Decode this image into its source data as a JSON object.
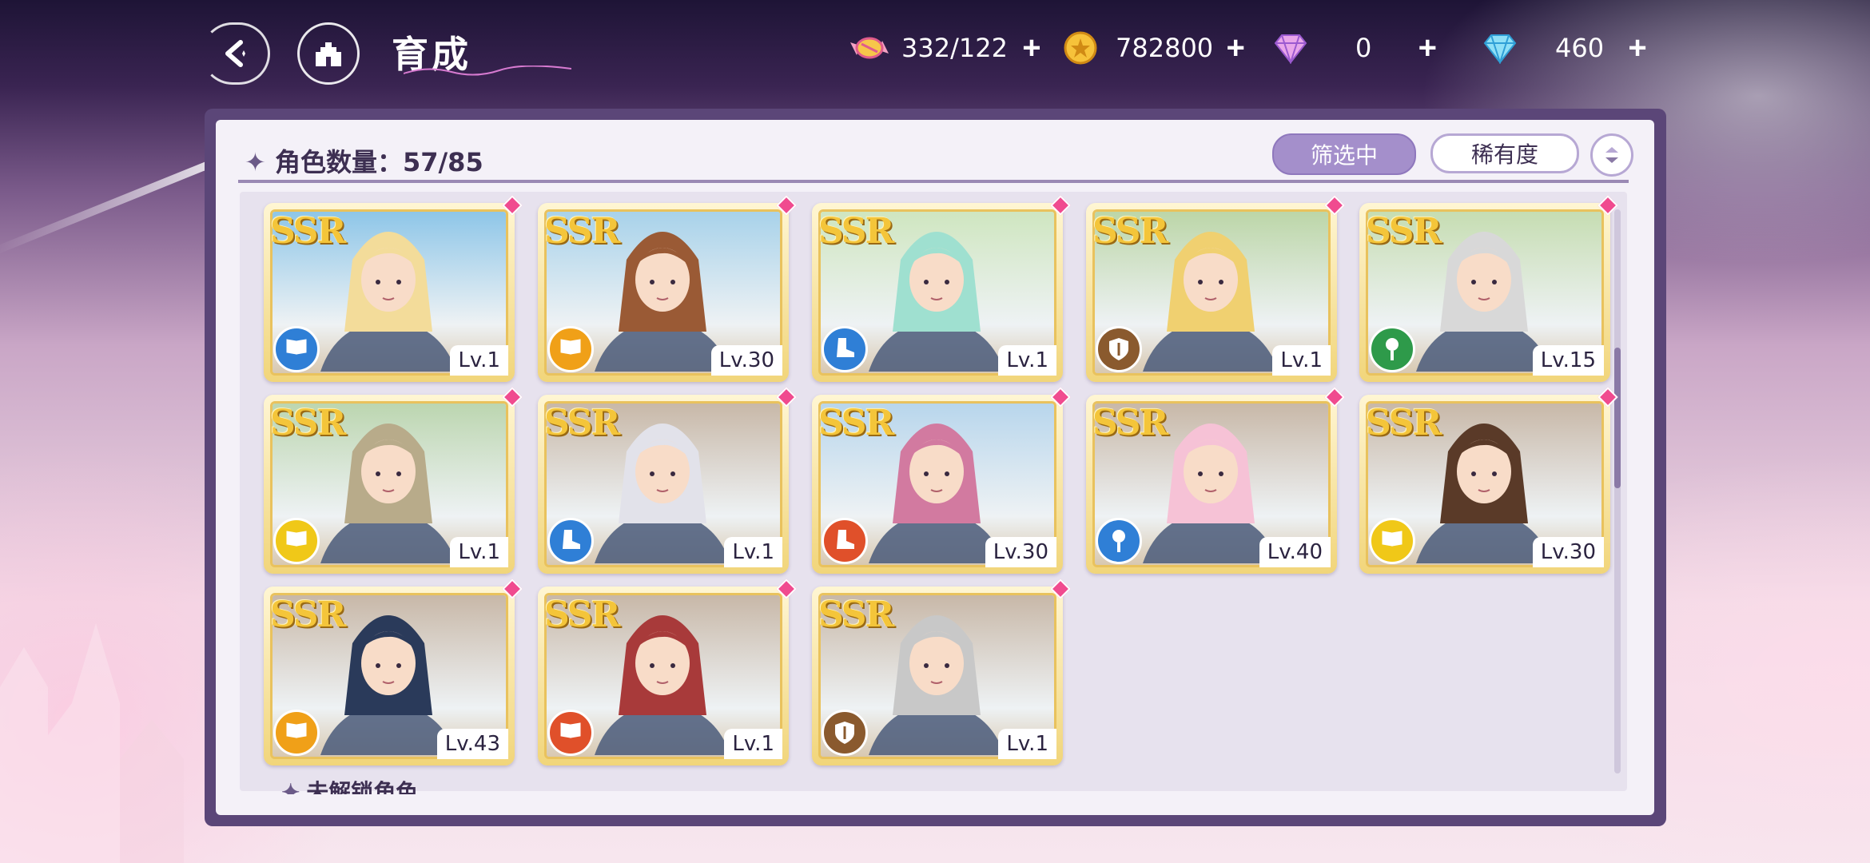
{
  "header": {
    "title": "育成"
  },
  "resources": [
    {
      "icon": "candy-icon",
      "value": "332/122",
      "plus": "+"
    },
    {
      "icon": "gold-coin-icon",
      "value": "782800",
      "plus": "+"
    },
    {
      "icon": "pink-diamond-icon",
      "value": "0",
      "plus": "+"
    },
    {
      "icon": "blue-diamond-icon",
      "value": "460",
      "plus": "+"
    }
  ],
  "panel": {
    "count_label": "角色数量：57/85",
    "filter_button": "筛选中",
    "rarity_button": "稀有度",
    "locked_label": "未解锁角色"
  },
  "cards": [
    {
      "rarity": "SSR",
      "level": "Lv.1",
      "type_color": "#2f7fd6",
      "type_icon": "book-icon",
      "hair": "#f3dc9a",
      "bg": "#8ec6e8"
    },
    {
      "rarity": "SSR",
      "level": "Lv.30",
      "type_color": "#f0a018",
      "type_icon": "book-icon",
      "hair": "#9a5a35",
      "bg": "#a8d2ea"
    },
    {
      "rarity": "SSR",
      "level": "Lv.1",
      "type_color": "#2f7fd6",
      "type_icon": "boot-icon",
      "hair": "#9fe0d0",
      "bg": "#cfe6c0"
    },
    {
      "rarity": "SSR",
      "level": "Lv.1",
      "type_color": "#8a5a2e",
      "type_icon": "shield-icon",
      "hair": "#f0d070",
      "bg": "#bcd6a8"
    },
    {
      "rarity": "SSR",
      "level": "Lv.15",
      "type_color": "#2e9a4a",
      "type_icon": "mic-icon",
      "hair": "#d8d8d8",
      "bg": "#c6ddb2"
    },
    {
      "rarity": "SSR",
      "level": "Lv.1",
      "type_color": "#f0c818",
      "type_icon": "book-icon",
      "hair": "#b8ab8a",
      "bg": "#bcd6b0"
    },
    {
      "rarity": "SSR",
      "level": "Lv.1",
      "type_color": "#2f7fd6",
      "type_icon": "boot-icon",
      "hair": "#e2e2ea",
      "bg": "#c8b8a8"
    },
    {
      "rarity": "SSR",
      "level": "Lv.30",
      "type_color": "#e0502a",
      "type_icon": "boot-icon",
      "hair": "#d27aa0",
      "bg": "#b8d6ec"
    },
    {
      "rarity": "SSR",
      "level": "Lv.40",
      "type_color": "#2f7fd6",
      "type_icon": "mic-icon",
      "hair": "#f6c2d6",
      "bg": "#c8b8a8"
    },
    {
      "rarity": "SSR",
      "level": "Lv.30",
      "type_color": "#f0c818",
      "type_icon": "book-icon",
      "hair": "#5a3a28",
      "bg": "#c8b8a8"
    },
    {
      "rarity": "SSR",
      "level": "Lv.43",
      "type_color": "#f0a018",
      "type_icon": "book-icon",
      "hair": "#2a3a5a",
      "bg": "#c8b8a8"
    },
    {
      "rarity": "SSR",
      "level": "Lv.1",
      "type_color": "#e0502a",
      "type_icon": "book-icon",
      "hair": "#a83a3a",
      "bg": "#c8b8a8"
    },
    {
      "rarity": "SSR",
      "level": "Lv.1",
      "type_color": "#8a5a2e",
      "type_icon": "shield-icon",
      "hair": "#c8c8c8",
      "bg": "#c8b8a8"
    }
  ]
}
